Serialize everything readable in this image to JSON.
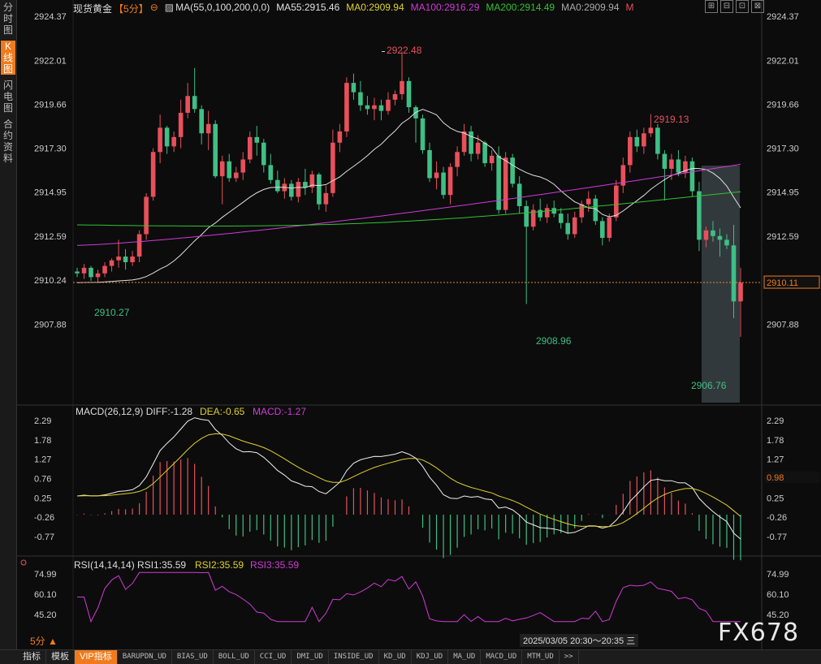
{
  "rail": [
    "分时图",
    "K线图",
    "闪电图",
    "合约资料"
  ],
  "rail_active": 1,
  "header": {
    "symbol": "现货黄金",
    "period": "【5分】",
    "ma_label": "MA(55,0,100,200,0,0)",
    "ma55": "MA55:2915.46",
    "ma0a": "MA0:2909.94",
    "ma100": "MA100:2916.29",
    "ma200": "MA200:2914.49",
    "ma0b": "MA0:2909.94",
    "m": "M"
  },
  "window_buttons": [
    "⊞",
    "⊟",
    "⊡",
    "⊠"
  ],
  "price_axis": [
    "2924.37",
    "2922.01",
    "2919.66",
    "2917.30",
    "2914.95",
    "2912.59",
    "2910.24",
    "2907.88"
  ],
  "current_price": "2910.11",
  "annotations": {
    "high": "2922.48",
    "high2": "2919.13",
    "low1": "2908.96",
    "low2": "2906.76",
    "start": "2910.27"
  },
  "macd": {
    "header": "MACD(26,12,9)",
    "diff": "DIFF:-1.28",
    "dea": "DEA:-0.65",
    "macd": "MACD:-1.27",
    "axis": [
      "2.29",
      "1.78",
      "1.27",
      "0.76",
      "0.25",
      "-0.26",
      "-0.77"
    ],
    "current": "0.98"
  },
  "rsi": {
    "header": "RSI(14,14,14)",
    "rsi1": "RSI1:35.59",
    "rsi2": "RSI2:35.59",
    "rsi3": "RSI3:35.59",
    "axis": [
      "74.99",
      "60.10",
      "45.20"
    ]
  },
  "period_btn": "5分 ▲",
  "timestamp": "2025/03/05 20:30～20:35 三",
  "watermark": "FX678",
  "bottom_tabs": [
    "指标",
    "模板",
    "VIP指标",
    "BARUPDN_UD",
    "BIAS_UD",
    "BOLL_UD",
    "CCI_UD",
    "DMI_UD",
    "INSIDE_UD",
    "KD_UD",
    "KDJ_UD",
    "MA_UD",
    "MACD_UD",
    "MTM_UD",
    ">>"
  ],
  "colors": {
    "up": "#e8505b",
    "down": "#3fbf85",
    "ma55": "#e0e0e0",
    "ma100": "#d03ad6",
    "ma200": "#33c233",
    "dea": "#e0d030",
    "rsi": "#d03ad6",
    "accent": "#f07b1d"
  },
  "chart_data": {
    "type": "candlestick",
    "price_range": [
      2906.3,
      2924.37
    ],
    "candles": [
      [
        2910.7,
        2910.9,
        2910.4,
        2910.6
      ],
      [
        2910.6,
        2911.1,
        2910.3,
        2910.9
      ],
      [
        2910.9,
        2911.0,
        2910.2,
        2910.4
      ],
      [
        2910.4,
        2910.8,
        2910.1,
        2910.6
      ],
      [
        2910.6,
        2911.2,
        2910.4,
        2911.0
      ],
      [
        2911.0,
        2911.4,
        2910.7,
        2911.3
      ],
      [
        2911.3,
        2912.4,
        2910.9,
        2911.5
      ],
      [
        2911.5,
        2911.9,
        2910.8,
        2911.2
      ],
      [
        2911.2,
        2911.8,
        2911.0,
        2911.5
      ],
      [
        2911.5,
        2912.9,
        2911.2,
        2912.7
      ],
      [
        2912.7,
        2914.9,
        2912.4,
        2914.7
      ],
      [
        2914.7,
        2917.3,
        2914.5,
        2917.1
      ],
      [
        2917.1,
        2919.1,
        2916.5,
        2918.4
      ],
      [
        2918.4,
        2918.5,
        2917.0,
        2917.4
      ],
      [
        2917.4,
        2918.2,
        2917.1,
        2917.9
      ],
      [
        2917.9,
        2919.9,
        2917.3,
        2919.2
      ],
      [
        2919.2,
        2920.8,
        2918.9,
        2920.1
      ],
      [
        2920.1,
        2921.6,
        2919.2,
        2919.4
      ],
      [
        2919.4,
        2919.6,
        2917.5,
        2918.1
      ],
      [
        2918.1,
        2919.3,
        2917.2,
        2918.6
      ],
      [
        2918.6,
        2918.8,
        2915.7,
        2915.8
      ],
      [
        2915.8,
        2916.9,
        2914.3,
        2916.6
      ],
      [
        2916.6,
        2917.0,
        2915.5,
        2915.7
      ],
      [
        2915.7,
        2916.3,
        2915.5,
        2916.0
      ],
      [
        2916.0,
        2917.1,
        2915.6,
        2916.7
      ],
      [
        2916.7,
        2918.2,
        2916.5,
        2917.9
      ],
      [
        2917.9,
        2918.5,
        2916.9,
        2917.6
      ],
      [
        2917.6,
        2917.8,
        2916.0,
        2916.4
      ],
      [
        2916.4,
        2917.0,
        2915.4,
        2915.6
      ],
      [
        2915.6,
        2916.1,
        2914.9,
        2915.0
      ],
      [
        2915.0,
        2915.7,
        2914.6,
        2915.4
      ],
      [
        2915.4,
        2915.6,
        2914.5,
        2914.7
      ],
      [
        2914.7,
        2915.7,
        2914.4,
        2915.5
      ],
      [
        2915.5,
        2916.2,
        2914.8,
        2915.2
      ],
      [
        2915.2,
        2916.1,
        2914.9,
        2915.9
      ],
      [
        2915.9,
        2916.0,
        2914.0,
        2914.3
      ],
      [
        2914.3,
        2915.3,
        2913.9,
        2914.9
      ],
      [
        2914.9,
        2918.3,
        2914.7,
        2917.6
      ],
      [
        2917.6,
        2918.6,
        2917.1,
        2918.2
      ],
      [
        2918.2,
        2921.1,
        2917.9,
        2920.8
      ],
      [
        2920.8,
        2921.3,
        2919.9,
        2920.3
      ],
      [
        2920.3,
        2920.9,
        2919.3,
        2919.6
      ],
      [
        2919.6,
        2920.1,
        2919.1,
        2919.4
      ],
      [
        2919.4,
        2920.0,
        2918.8,
        2919.6
      ],
      [
        2919.6,
        2919.9,
        2918.8,
        2919.3
      ],
      [
        2919.3,
        2920.3,
        2919.1,
        2919.9
      ],
      [
        2919.9,
        2920.4,
        2919.6,
        2920.2
      ],
      [
        2920.2,
        2922.48,
        2919.9,
        2920.9
      ],
      [
        2920.9,
        2921.1,
        2919.2,
        2919.5
      ],
      [
        2919.5,
        2919.6,
        2917.6,
        2918.9
      ],
      [
        2918.9,
        2919.1,
        2917.0,
        2917.2
      ],
      [
        2917.2,
        2917.6,
        2915.5,
        2915.7
      ],
      [
        2915.7,
        2916.6,
        2915.1,
        2916.0
      ],
      [
        2916.0,
        2916.3,
        2914.6,
        2914.8
      ],
      [
        2914.8,
        2916.5,
        2914.3,
        2916.3
      ],
      [
        2916.3,
        2917.4,
        2915.8,
        2917.1
      ],
      [
        2917.1,
        2918.6,
        2916.9,
        2918.2
      ],
      [
        2918.2,
        2918.5,
        2916.6,
        2917.0
      ],
      [
        2917.0,
        2918.0,
        2916.7,
        2917.6
      ],
      [
        2917.6,
        2917.7,
        2916.3,
        2916.5
      ],
      [
        2916.5,
        2917.2,
        2916.1,
        2916.9
      ],
      [
        2916.9,
        2917.4,
        2913.8,
        2914.0
      ],
      [
        2914.0,
        2917.1,
        2913.8,
        2916.8
      ],
      [
        2916.8,
        2917.0,
        2915.2,
        2915.4
      ],
      [
        2915.4,
        2915.8,
        2913.8,
        2914.2
      ],
      [
        2914.2,
        2914.5,
        2908.96,
        2913.1
      ],
      [
        2913.1,
        2914.3,
        2912.9,
        2914.0
      ],
      [
        2914.0,
        2914.6,
        2913.4,
        2913.6
      ],
      [
        2913.6,
        2914.3,
        2913.3,
        2914.1
      ],
      [
        2914.1,
        2914.5,
        2913.6,
        2913.8
      ],
      [
        2913.8,
        2914.1,
        2913.0,
        2913.3
      ],
      [
        2913.3,
        2913.8,
        2912.4,
        2912.7
      ],
      [
        2912.7,
        2913.9,
        2912.5,
        2913.6
      ],
      [
        2913.6,
        2914.5,
        2913.3,
        2914.3
      ],
      [
        2914.3,
        2915.0,
        2913.9,
        2914.6
      ],
      [
        2914.6,
        2914.8,
        2913.2,
        2913.4
      ],
      [
        2913.4,
        2913.6,
        2912.1,
        2912.5
      ],
      [
        2912.5,
        2913.8,
        2912.3,
        2913.6
      ],
      [
        2913.6,
        2915.6,
        2913.4,
        2915.3
      ],
      [
        2915.3,
        2916.8,
        2914.9,
        2916.4
      ],
      [
        2916.4,
        2918.2,
        2916.0,
        2917.9
      ],
      [
        2917.9,
        2918.3,
        2917.1,
        2917.4
      ],
      [
        2917.4,
        2918.4,
        2917.0,
        2918.1
      ],
      [
        2918.1,
        2919.13,
        2917.9,
        2918.4
      ],
      [
        2918.4,
        2918.6,
        2916.7,
        2917.0
      ],
      [
        2917.0,
        2917.2,
        2914.5,
        2916.2
      ],
      [
        2916.2,
        2917.0,
        2915.6,
        2916.7
      ],
      [
        2916.7,
        2917.2,
        2915.8,
        2916.0
      ],
      [
        2916.0,
        2916.9,
        2915.7,
        2916.6
      ],
      [
        2916.6,
        2916.8,
        2914.7,
        2915.0
      ],
      [
        2915.0,
        2915.5,
        2911.8,
        2912.4
      ],
      [
        2912.4,
        2913.1,
        2912.0,
        2912.9
      ],
      [
        2912.9,
        2913.4,
        2912.3,
        2912.6
      ],
      [
        2912.6,
        2913.0,
        2911.5,
        2912.4
      ],
      [
        2912.4,
        2912.7,
        2911.9,
        2912.1
      ],
      [
        2912.1,
        2913.2,
        2908.2,
        2909.1
      ],
      [
        2909.1,
        2910.9,
        2907.2,
        2910.1
      ]
    ]
  }
}
